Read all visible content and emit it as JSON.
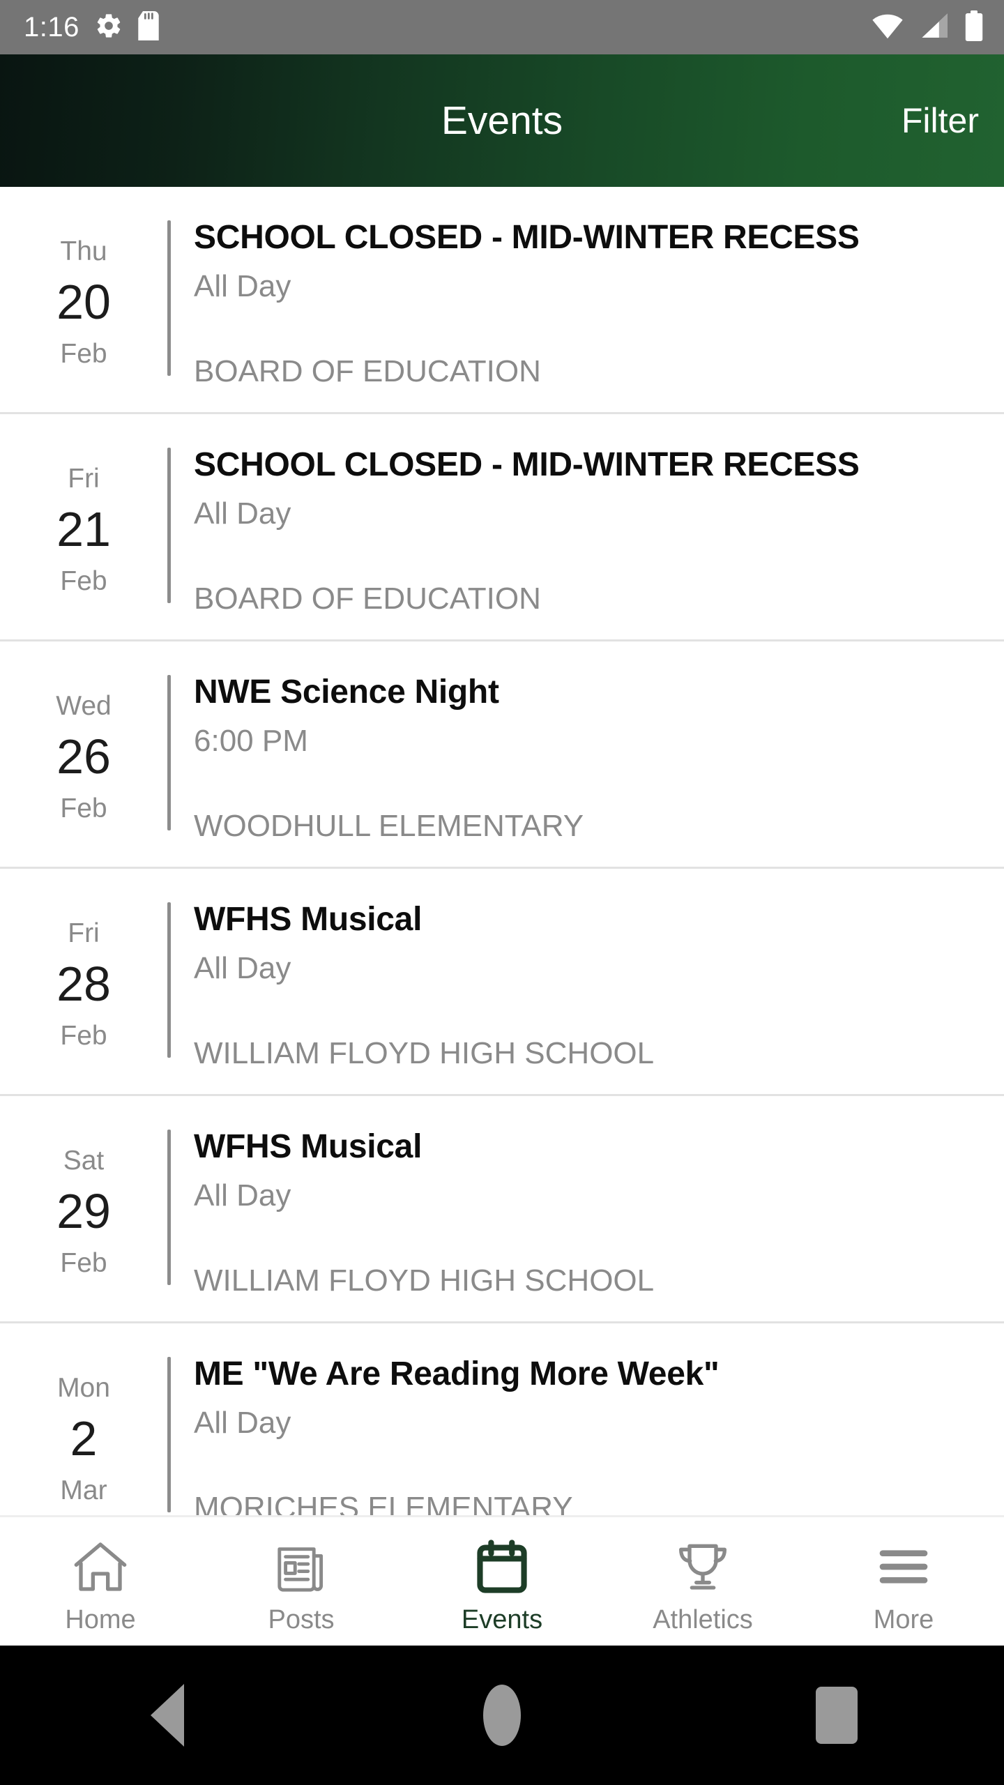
{
  "status_bar": {
    "clock": "1:16",
    "left_icons": [
      "gear-icon",
      "sd-card-icon"
    ],
    "right_icons": [
      "wifi-icon",
      "cell-signal-icon",
      "battery-icon"
    ],
    "background_color": "#757575",
    "foreground_color": "#ffffff"
  },
  "appbar": {
    "title": "Events",
    "action_label": "Filter",
    "gradient_start": "#091511",
    "gradient_end": "#216230",
    "text_color": "#ffffff"
  },
  "events": [
    {
      "dow": "Thu",
      "day": "20",
      "month": "Feb",
      "title": "SCHOOL CLOSED - MID-WINTER RECESS",
      "time": "All Day",
      "location": "BOARD OF EDUCATION"
    },
    {
      "dow": "Fri",
      "day": "21",
      "month": "Feb",
      "title": "SCHOOL CLOSED - MID-WINTER RECESS",
      "time": "All Day",
      "location": "BOARD OF EDUCATION"
    },
    {
      "dow": "Wed",
      "day": "26",
      "month": "Feb",
      "title": "NWE Science Night",
      "time": "6:00 PM",
      "location": "WOODHULL ELEMENTARY"
    },
    {
      "dow": "Fri",
      "day": "28",
      "month": "Feb",
      "title": "WFHS Musical",
      "time": "All Day",
      "location": "WILLIAM FLOYD HIGH SCHOOL"
    },
    {
      "dow": "Sat",
      "day": "29",
      "month": "Feb",
      "title": "WFHS Musical",
      "time": "All Day",
      "location": "WILLIAM FLOYD HIGH SCHOOL"
    },
    {
      "dow": "Mon",
      "day": "2",
      "month": "Mar",
      "title": "ME \"We Are Reading More Week\"",
      "time": "All Day",
      "location": "MORICHES ELEMENTARY"
    }
  ],
  "tabbar": {
    "active_color": "#1d3d27",
    "inactive_color": "#8a8a8a",
    "tabs": [
      {
        "label": "Home",
        "icon": "home-icon",
        "active": false
      },
      {
        "label": "Posts",
        "icon": "newspaper-icon",
        "active": false
      },
      {
        "label": "Events",
        "icon": "calendar-icon",
        "active": true
      },
      {
        "label": "Athletics",
        "icon": "trophy-icon",
        "active": false
      },
      {
        "label": "More",
        "icon": "hamburger-menu-icon",
        "active": false
      }
    ]
  },
  "navbar": {
    "buttons": [
      "back-triangle-icon",
      "home-circle-icon",
      "recents-square-icon"
    ],
    "background_color": "#000000",
    "icon_color": "#9a9a9a"
  }
}
